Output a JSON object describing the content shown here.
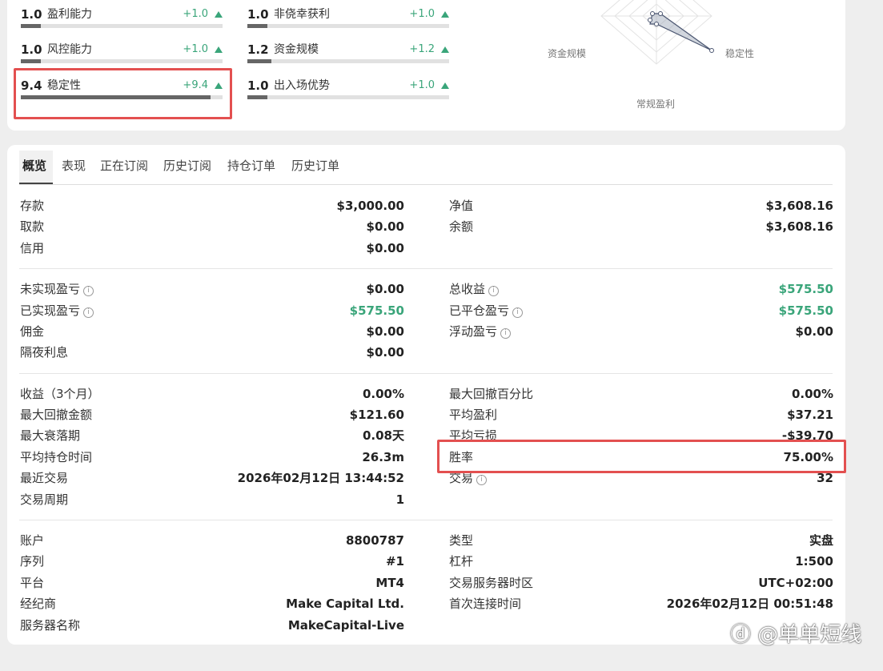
{
  "scores": [
    {
      "value": "1.0",
      "label": "盈利能力",
      "delta": "+1.0",
      "fill": 0.1
    },
    {
      "value": "1.0",
      "label": "非侥幸获利",
      "delta": "+1.0",
      "fill": 0.1
    },
    {
      "value": "1.0",
      "label": "风控能力",
      "delta": "+1.0",
      "fill": 0.1
    },
    {
      "value": "1.2",
      "label": "资金规模",
      "delta": "+1.2",
      "fill": 0.12
    },
    {
      "value": "9.4",
      "label": "稳定性",
      "delta": "+9.4",
      "fill": 0.94
    },
    {
      "value": "1.0",
      "label": "出入场优势",
      "delta": "+1.0",
      "fill": 0.1
    }
  ],
  "radar": {
    "axes": {
      "left": "资金规模",
      "right": "稳定性",
      "bottom": "常规盈利"
    }
  },
  "tabs": [
    "概览",
    "表现",
    "正在订阅",
    "历史订阅",
    "持仓订单",
    "历史订单"
  ],
  "active_tab": "概览",
  "section1": {
    "left": [
      {
        "k": "存款",
        "v": "$3,000.00"
      },
      {
        "k": "取款",
        "v": "$0.00"
      },
      {
        "k": "信用",
        "v": "$0.00"
      }
    ],
    "right": [
      {
        "k": "净值",
        "v": "$3,608.16"
      },
      {
        "k": "余额",
        "v": "$3,608.16"
      }
    ]
  },
  "section2": {
    "left": [
      {
        "k": "未实现盈亏",
        "v": "$0.00",
        "info": true
      },
      {
        "k": "已实现盈亏",
        "v": "$575.50",
        "info": true,
        "green": true
      },
      {
        "k": "佣金",
        "v": "$0.00"
      },
      {
        "k": "隔夜利息",
        "v": "$0.00"
      }
    ],
    "right": [
      {
        "k": "总收益",
        "v": "$575.50",
        "info": true,
        "green": true
      },
      {
        "k": "已平仓盈亏",
        "v": "$575.50",
        "info": true,
        "green": true
      },
      {
        "k": "浮动盈亏",
        "v": "$0.00",
        "info": true
      }
    ]
  },
  "section3": {
    "left": [
      {
        "k": "收益（3个月）",
        "v": "0.00%"
      },
      {
        "k": "最大回撤金额",
        "v": "$121.60"
      },
      {
        "k": "最大衰落期",
        "v": "0.08天"
      },
      {
        "k": "平均持仓时间",
        "v": "26.3m"
      },
      {
        "k": "最近交易",
        "v": "2026年02月12日 13:44:52"
      },
      {
        "k": "交易周期",
        "v": "1"
      }
    ],
    "right": [
      {
        "k": "最大回撤百分比",
        "v": "0.00%"
      },
      {
        "k": "平均盈利",
        "v": "$37.21"
      },
      {
        "k": "平均亏损",
        "v": "-$39.70"
      },
      {
        "k": "胜率",
        "v": "75.00%"
      },
      {
        "k": "交易",
        "v": "32",
        "info": true
      }
    ]
  },
  "section4": {
    "left": [
      {
        "k": "账户",
        "v": "8800787"
      },
      {
        "k": "序列",
        "v": "#1"
      },
      {
        "k": "平台",
        "v": "MT4"
      },
      {
        "k": "经纪商",
        "v": "Make Capital Ltd."
      },
      {
        "k": "服务器名称",
        "v": "MakeCapital-Live"
      }
    ],
    "right": [
      {
        "k": "类型",
        "v": "实盘"
      },
      {
        "k": "杠杆",
        "v": "1:500"
      },
      {
        "k": "交易服务器时区",
        "v": "UTC+02:00"
      },
      {
        "k": "首次连接时间",
        "v": "2026年02月12日 00:51:48"
      }
    ]
  },
  "info_glyph": "i",
  "watermark": "ⓓ @单单短线",
  "colors": {
    "positive": "#3aa57a",
    "highlight": "#e35050",
    "bar_fill": "#666666"
  }
}
